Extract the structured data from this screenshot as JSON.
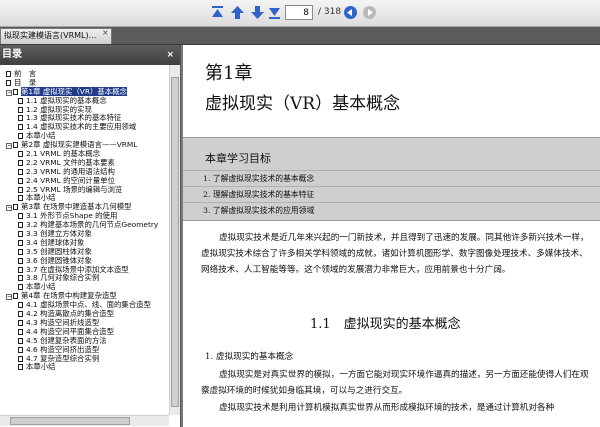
{
  "toolbar": {
    "page_value": "8",
    "page_total": "/ 318",
    "icons": [
      "first-page-icon",
      "prev-page-icon",
      "next-page-icon",
      "last-page-icon",
      "back-icon",
      "forward-icon"
    ]
  },
  "tab": {
    "title": "拟现实建模语言(VRML)...",
    "close": "×"
  },
  "sidebar": {
    "title": "目录",
    "close": "×",
    "toc": [
      {
        "level": 0,
        "label": "前　言"
      },
      {
        "level": 0,
        "label": "目　录"
      },
      {
        "level": 0,
        "exp": "−",
        "label": "第1章 虚拟现实（VR）基本概念",
        "selected": true
      },
      {
        "level": 1,
        "label": "1.1 虚拟现实的基本概念"
      },
      {
        "level": 1,
        "label": "1.2 虚拟现实的实现"
      },
      {
        "level": 1,
        "label": "1.3 虚拟现实技术的基本特征"
      },
      {
        "level": 1,
        "label": "1.4 虚拟现实技术的主要应用领域"
      },
      {
        "level": 1,
        "label": "本章小结"
      },
      {
        "level": 0,
        "exp": "−",
        "label": "第2章 虚拟现实建模语言——VRML"
      },
      {
        "level": 1,
        "label": "2.1 VRML 的基本概念"
      },
      {
        "level": 1,
        "label": "2.2 VRML 文件的基本要素"
      },
      {
        "level": 1,
        "label": "2.3 VRML 的通用语法结构"
      },
      {
        "level": 1,
        "label": "2.4 VRML 的空间计量单位"
      },
      {
        "level": 1,
        "label": "2.5 VRML 场景的编辑与浏览"
      },
      {
        "level": 1,
        "label": "本章小结"
      },
      {
        "level": 0,
        "exp": "−",
        "label": "第3章 在场景中建造基本几何模型"
      },
      {
        "level": 1,
        "label": "3.1 外形节点Shape 的使用"
      },
      {
        "level": 1,
        "label": "3.2 构建基本场景的几何节点Geometry"
      },
      {
        "level": 1,
        "label": "3.3 创建立方体对象"
      },
      {
        "level": 1,
        "label": "3.4 创建球体对象"
      },
      {
        "level": 1,
        "label": "3.5 创建圆柱体对象"
      },
      {
        "level": 1,
        "label": "3.6 创建圆锥体对象"
      },
      {
        "level": 1,
        "label": "3.7 在虚拟场景中添加文本造型"
      },
      {
        "level": 1,
        "label": "3.8 几何对象综合实例"
      },
      {
        "level": 1,
        "label": "本章小结"
      },
      {
        "level": 0,
        "exp": "−",
        "label": "第4章 在场景中构建复杂造型"
      },
      {
        "level": 1,
        "label": "4.1 虚拟场景中点、线、面的集合造型"
      },
      {
        "level": 1,
        "label": "4.2 构造离散点的集合造型"
      },
      {
        "level": 1,
        "label": "4.3 构造空间折线造型"
      },
      {
        "level": 1,
        "label": "4.4 构造空间平面集合造型"
      },
      {
        "level": 1,
        "label": "4.5 创建复杂表面的方法"
      },
      {
        "level": 1,
        "label": "4.6 构造空间挤出造型"
      },
      {
        "level": 1,
        "label": "4.7 复杂造型综合实例"
      },
      {
        "level": 1,
        "label": "本章小结"
      }
    ]
  },
  "document": {
    "chapter_label": "第1章",
    "chapter_title": "虚拟现实（VR）基本概念",
    "objectives_title": "本章学习目标",
    "objectives": [
      "1. 了解虚拟现实技术的基本概念",
      "2. 理解虚拟现实技术的基本特征",
      "3. 了解虚拟现实技术的应用领域"
    ],
    "intro": "虚拟现实技术是近几年来兴起的一门新技术，并且得到了迅速的发展。同其他许多新兴技术一样，虚拟现实技术综合了许多相关学科领域的成就，诸如计算机图形学、数字图像处理技术、多媒体技术、网络技术、人工智能等等。这个领域的发展潜力非常巨大，应用前景也十分广阔。",
    "section_title": "1.1　虚拟现实的基本概念",
    "subheading": "1. 虚拟现实的基本概念",
    "para2": "虚拟现实是对真实世界的模拟，一方面它能对现实环境作逼真的描述，另一方面还能使得人们在观察虚拟环境的时候犹如身临其境，可以与之进行交互。",
    "para3": "虚拟现实技术是利用计算机模拟真实世界从而形成模拟环境的技术，是通过计算机对各种"
  },
  "colors": {
    "selection": "#1f3b8a",
    "icon_blue": "#2f63c9",
    "objectives_bg": "#cfcfcf"
  }
}
